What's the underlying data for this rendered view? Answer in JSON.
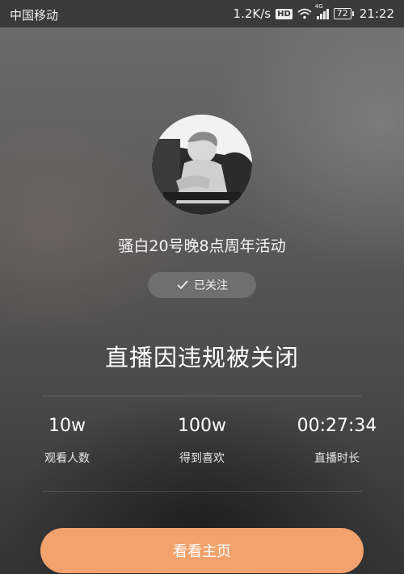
{
  "status_bar": {
    "carrier": "中国移动",
    "network_speed": "1.2K/s",
    "hd_badge": "HD",
    "net_type": "4G",
    "battery": "72",
    "time": "21:22"
  },
  "profile": {
    "name": "骚白20号晚8点周年活动",
    "follow_label": "已关注"
  },
  "headline": "直播因违规被关闭",
  "stats": [
    {
      "value": "10w",
      "label": "观看人数"
    },
    {
      "value": "100w",
      "label": "得到喜欢"
    },
    {
      "value": "00:27:34",
      "label": "直播时长"
    }
  ],
  "home_button_label": "看看主页",
  "colors": {
    "accent": "#f1a26d",
    "follow_bg": "#787878"
  }
}
